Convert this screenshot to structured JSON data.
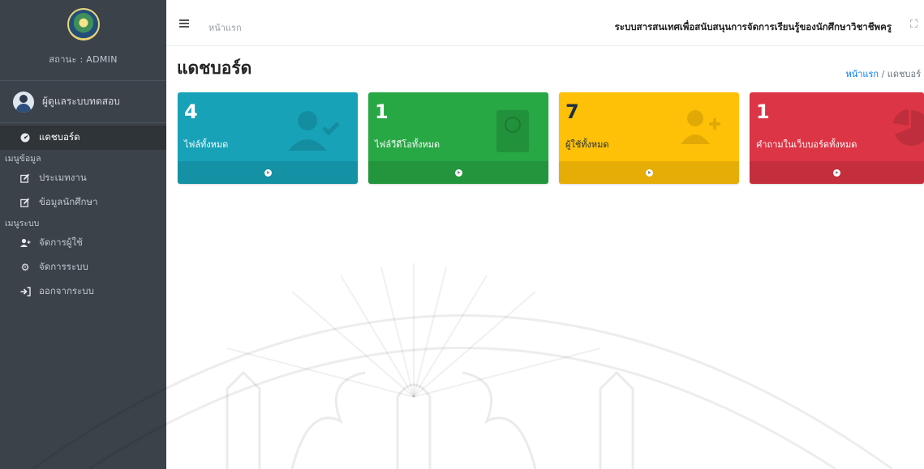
{
  "sidebar": {
    "status": "สถานะ : ADMIN",
    "user_name": "ผู้ดูแลระบบทดสอบ",
    "dashboard_label": "แดชบอร์ด",
    "menu_data_header": "เมนูข้อมูล",
    "menu_data_items": [
      {
        "label": "ประเมทงาน",
        "icon": "edit-icon"
      },
      {
        "label": "ข้อมูลนักศึกษา",
        "icon": "edit-icon"
      }
    ],
    "menu_system_header": "เมนูระบบ",
    "menu_system_items": [
      {
        "label": "จัดการผู้ใช้",
        "icon": "user-plus-icon"
      },
      {
        "label": "จัดการระบบ",
        "icon": "gear-icon"
      },
      {
        "label": "ออกจากระบบ",
        "icon": "sign-out-icon"
      }
    ]
  },
  "topbar": {
    "home_link": "หน้าแรก",
    "system_title": "ระบบสารสนเทศเพื่อสนับสนุนการจัดการเรียนรู้ของนักศึกษาวิชาชีพครู"
  },
  "content": {
    "page_title": "แดชบอร์ด",
    "breadcrumb_home": "หน้าแรก",
    "breadcrumb_sep": "/",
    "breadcrumb_current": "แดชบอร์"
  },
  "stats": [
    {
      "count": "4",
      "label": "ไฟล์ทั้งหมด",
      "color": "#17a2b8",
      "icon": "user-check-icon"
    },
    {
      "count": "1",
      "label": "ไฟล์วีดีโอทั้งหมด",
      "color": "#28a745",
      "icon": "book-icon"
    },
    {
      "count": "7",
      "label": "ผู้ใช้ทั้งหมด",
      "color": "#ffc107",
      "icon": "user-plus-icon"
    },
    {
      "count": "1",
      "label": "คำถามในเว็บบอร์ดทั้งหมด",
      "color": "#dc3545",
      "icon": "chart-pie-icon"
    }
  ]
}
